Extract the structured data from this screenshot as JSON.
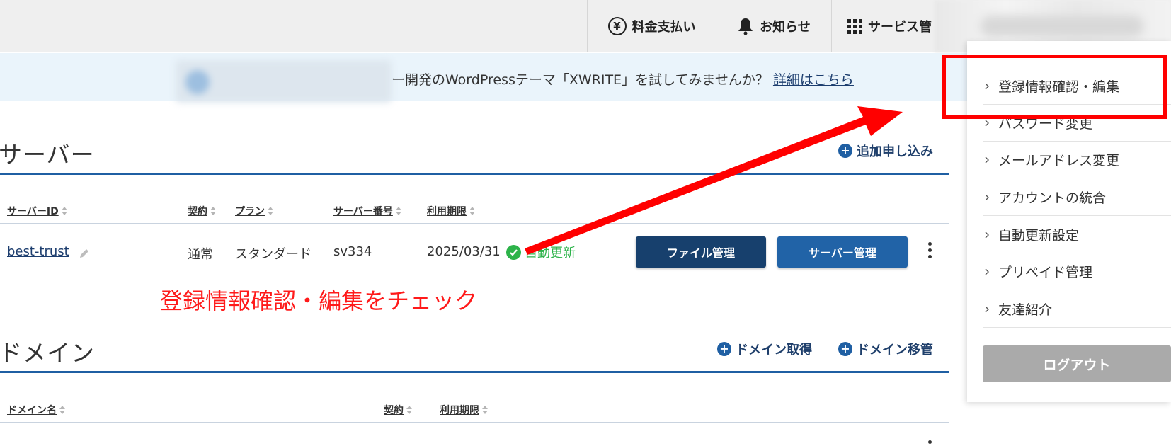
{
  "header": {
    "payment_label": "料金支払い",
    "notice_label": "お知らせ",
    "service_label": "サービス管"
  },
  "banner": {
    "text": "ー開発のWordPressテーマ「XWRITE」を試してみませんか？",
    "link": "詳細はこちら"
  },
  "server_section": {
    "title": "サーバー",
    "add_label": "追加申し込み",
    "columns": [
      "サーバーID",
      "契約",
      "プラン",
      "サーバー番号",
      "利用期限"
    ],
    "row": {
      "server_id": "best-trust",
      "contract": "通常",
      "plan": "スタンダード",
      "server_number": "sv334",
      "expiry": "2025/03/31",
      "auto_renew": "自動更新",
      "file_button": "ファイル管理",
      "server_button": "サーバー管理"
    }
  },
  "annotation": "登録情報確認・編集をチェック",
  "domain_section": {
    "title": "ドメイン",
    "acquire_label": "ドメイン取得",
    "transfer_label": "ドメイン移管",
    "columns": [
      "ドメイン名",
      "契約",
      "利用期限"
    ]
  },
  "account_menu": {
    "items": [
      {
        "label": "登録情報確認・編集"
      },
      {
        "label": "パスワード変更"
      },
      {
        "label": "メールアドレス変更"
      },
      {
        "label": "アカウントの統合"
      },
      {
        "label": "自動更新設定"
      },
      {
        "label": "プリペイド管理"
      },
      {
        "label": "友達紹介"
      }
    ],
    "logout_label": "ログアウト"
  },
  "colors": {
    "accent": "#1f5fa3",
    "primary_button": "#17406d",
    "secondary_button": "#2163a7",
    "success": "#2db34a",
    "annotation": "#ff0000"
  }
}
